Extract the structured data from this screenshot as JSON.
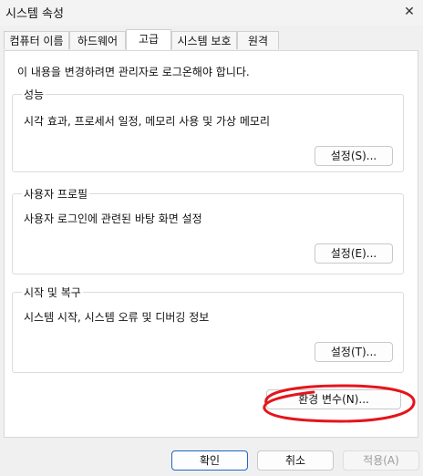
{
  "window": {
    "title": "시스템 속성",
    "close_icon": "close-icon"
  },
  "tabs": [
    {
      "label": "컴퓨터 이름",
      "active": false
    },
    {
      "label": "하드웨어",
      "active": false
    },
    {
      "label": "고급",
      "active": true
    },
    {
      "label": "시스템 보호",
      "active": false
    },
    {
      "label": "원격",
      "active": false
    }
  ],
  "notice": "이 내용을 변경하려면 관리자로 로그온해야 합니다.",
  "groups": {
    "performance": {
      "title": "성능",
      "description": "시각 효과, 프로세서 일정, 메모리 사용 및 가상 메모리",
      "button": "설정(S)..."
    },
    "user_profiles": {
      "title": "사용자 프로필",
      "description": "사용자 로그인에 관련된 바탕 화면 설정",
      "button": "설정(E)..."
    },
    "startup_recovery": {
      "title": "시작 및 복구",
      "description": "시스템 시작, 시스템 오류 및 디버깅 정보",
      "button": "설정(T)..."
    }
  },
  "env_button": "환경 변수(N)...",
  "footer": {
    "ok": "확인",
    "cancel": "취소",
    "apply": "적용(A)"
  },
  "colors": {
    "annotation_circle": "#e5141b",
    "default_button_border": "#1f67c5"
  }
}
